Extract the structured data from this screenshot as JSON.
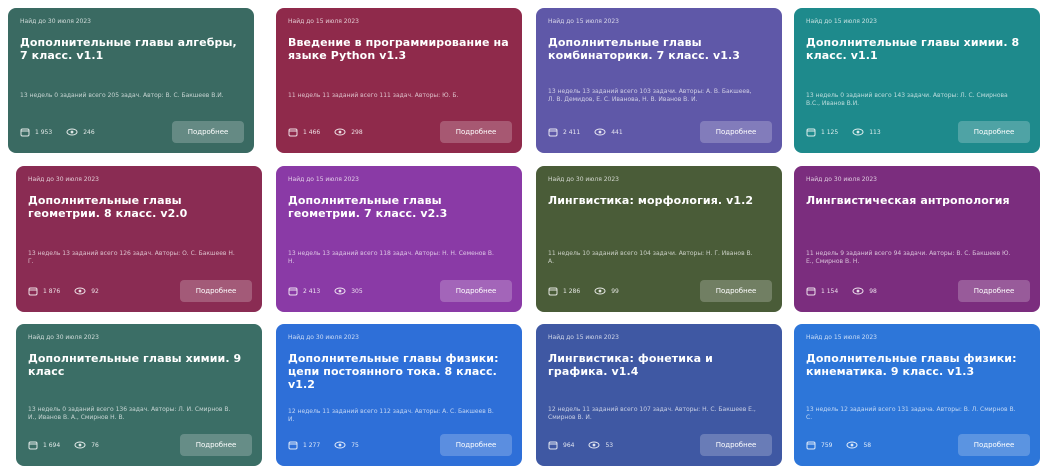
{
  "cards": [
    {
      "color": "#3a6a62",
      "badge": "Найд до 30 июля 2023",
      "title": "Дополнительные главы алгебры, 7 класс. v1.1",
      "meta": "13 недель 0 заданий всего 205 задач. Автор: В. С. Бакшеев В.И.",
      "stat1": "1 953",
      "stat2": "246",
      "button": "Подробнее"
    },
    {
      "color": "#8f2a4b",
      "badge": "Найд до 15 июля 2023",
      "title": "Введение в программирование на языке Python v1.3",
      "meta": "11 недель 11 заданий всего 111 задач. Авторы: Ю. Б.",
      "stat1": "1 466",
      "stat2": "298",
      "button": "Подробнее"
    },
    {
      "color": "#5f58a8",
      "badge": "Найд до 15 июля 2023",
      "title": "Дополнительные главы комбинаторики. 7 класс. v1.3",
      "meta": "13 недель 13 заданий всего 103 задачи. Авторы: А. В. Бакшеев, Л. В. Демидов, Е. С. Иванова, Н. В. Иванов В. И.",
      "stat1": "2 411",
      "stat2": "441",
      "button": "Подробнее"
    },
    {
      "color": "#1e8a8c",
      "badge": "Найд до 15 июля 2023",
      "title": "Дополнительные главы химии. 8 класс. v1.1",
      "meta": "13 недель 0 заданий всего 143 задачи. Авторы: Л. С. Смирнова В.С., Иванов В.И.",
      "stat1": "1 125",
      "stat2": "113",
      "button": "Подробнее"
    },
    {
      "color": "#8a2c53",
      "badge": "Найд до 30 июля 2023",
      "title": "Дополнительные главы геометрии. 8 класс. v2.0",
      "meta": "13 недель 13 заданий всего 126 задач. Авторы: О. С. Бакшеев Н. Г.",
      "stat1": "1 876",
      "stat2": "92",
      "button": "Подробнее"
    },
    {
      "color": "#8a3aa6",
      "badge": "Найд до 15 июля 2023",
      "title": "Дополнительные главы геометрии. 7 класс. v2.3",
      "meta": "13 недель 13 заданий всего 118 задач. Авторы: Н. Н. Семенов В. Н.",
      "stat1": "2 413",
      "stat2": "305",
      "button": "Подробнее"
    },
    {
      "color": "#4a5c38",
      "badge": "Найд до 30 июля 2023",
      "title": "Лингвистика: морфология. v1.2",
      "meta": "11 недель 10 заданий всего 104 задачи. Авторы: Н. Г. Иванов В. А.",
      "stat1": "1 286",
      "stat2": "99",
      "button": "Подробнее"
    },
    {
      "color": "#7b2d7e",
      "badge": "Найд до 30 июля 2023",
      "title": "Лингвистическая антропология",
      "meta": "11 недель 9 заданий всего 94 задачи. Авторы: В. С. Бакшеев Ю. Е., Смирнов В. Н.",
      "stat1": "1 154",
      "stat2": "98",
      "button": "Подробнее"
    },
    {
      "color": "#3b6e66",
      "badge": "Найд до 30 июля 2023",
      "title": "Дополнительные главы химии. 9 класс",
      "meta": "13 недель 0 заданий всего 136 задач. Авторы: Л. И. Смирнов В. И., Иванов В. А., Смирнов Н. В.",
      "stat1": "1 694",
      "stat2": "76",
      "button": "Подробнее"
    },
    {
      "color": "#2e6fd8",
      "badge": "Найд до 30 июля 2023",
      "title": "Дополнительные главы физики: цепи постоянного тока. 8 класс. v1.2",
      "meta": "12 недель 11 заданий всего 112 задач. Авторы: А. С. Бакшеев В. И.",
      "stat1": "1 277",
      "stat2": "75",
      "button": "Подробнее"
    },
    {
      "color": "#3f58a3",
      "badge": "Найд до 15 июля 2023",
      "title": "Лингвистика: фонетика и графика. v1.4",
      "meta": "12 недель 11 заданий всего 107 задач. Авторы: Н. С. Бакшеев Е., Смирнов В. И.",
      "stat1": "964",
      "stat2": "53",
      "button": "Подробнее"
    },
    {
      "color": "#2d76d9",
      "badge": "Найд до 15 июля 2023",
      "title": "Дополнительные главы физики: кинематика. 9 класс. v1.3",
      "meta": "13 недель 12 заданий всего 131 задача. Авторы: В. Л. Смирнов В. С.",
      "stat1": "759",
      "stat2": "58",
      "button": "Подробнее"
    }
  ]
}
